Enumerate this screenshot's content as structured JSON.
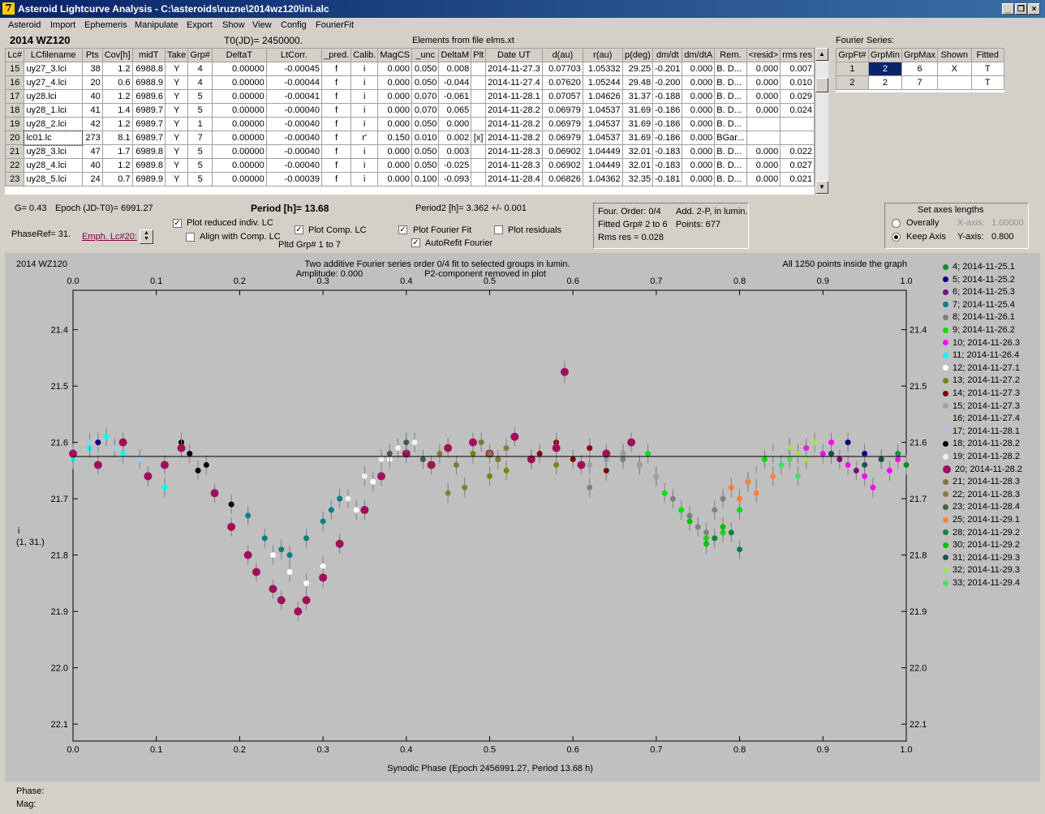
{
  "window": {
    "title": "Asteroid Lightcurve Analysis - C:\\asteroids\\ruzne\\2014wz120\\ini.alc",
    "icon_glyph": "7"
  },
  "menu": [
    "Asteroid",
    "Import",
    "Ephemeris",
    "Manipulate",
    "Export",
    "Show",
    "View",
    "Config",
    "FourierFit"
  ],
  "header": {
    "object": "2014 WZ120",
    "t0": "T0(JD)= 2450000.",
    "elements": "Elements from file elms.xt",
    "fourier_label": "Fourier Series:"
  },
  "table": {
    "columns": [
      "Lc#",
      "LCfilename",
      "Pts",
      "Cov[h]",
      "midT",
      "Take",
      "Grp#",
      "DeltaT",
      "LtCorr.",
      "_pred.",
      "Calib.",
      "MagCS",
      "_unc",
      "DeltaM",
      "Plt",
      "Date UT",
      "d(au)",
      "r(au)",
      "p(deg)",
      "dm/dt",
      "dm/dtA",
      "Rem.",
      "<resid>",
      "rms res"
    ],
    "rows": [
      [
        "15",
        "uy27_3.lci",
        "38",
        "1.2",
        "6988.8",
        "Y",
        "4",
        "0.00000",
        "-0.00045",
        "f",
        "i",
        "0.000",
        "0.050",
        "0.008",
        "",
        "2014-11-27.3",
        "0.07703",
        "1.05332",
        "29.25",
        "-0.201",
        "0.000",
        "B. D...",
        "0.000",
        "0.007"
      ],
      [
        "16",
        "uy27_4.lci",
        "20",
        "0.6",
        "6988.9",
        "Y",
        "4",
        "0.00000",
        "-0.00044",
        "f",
        "i",
        "0.000",
        "0.050",
        "-0.044",
        "",
        "2014-11-27.4",
        "0.07620",
        "1.05244",
        "29.48",
        "-0.200",
        "0.000",
        "B. D...",
        "0.000",
        "0.010"
      ],
      [
        "17",
        "uy28.lci",
        "40",
        "1.2",
        "6989.6",
        "Y",
        "5",
        "0.00000",
        "-0.00041",
        "f",
        "i",
        "0.000",
        "0.070",
        "-0.061",
        "",
        "2014-11-28.1",
        "0.07057",
        "1.04626",
        "31.37",
        "-0.188",
        "0.000",
        "B. D...",
        "0.000",
        "0.029"
      ],
      [
        "18",
        "uy28_1.lci",
        "41",
        "1.4",
        "6989.7",
        "Y",
        "5",
        "0.00000",
        "-0.00040",
        "f",
        "i",
        "0.000",
        "0.070",
        "0.065",
        "",
        "2014-11-28.2",
        "0.06979",
        "1.04537",
        "31.69",
        "-0.186",
        "0.000",
        "B. D...",
        "0.000",
        "0.024"
      ],
      [
        "19",
        "uy28_2.lci",
        "42",
        "1.2",
        "6989.7",
        "Y",
        "1",
        "0.00000",
        "-0.00040",
        "f",
        "i",
        "0.000",
        "0.050",
        "0.000",
        "",
        "2014-11-28.2",
        "0.06979",
        "1.04537",
        "31.69",
        "-0.186",
        "0.000",
        "B. D...",
        "",
        ""
      ],
      [
        "20",
        "lc01.lc",
        "273",
        "8.1",
        "6989.7",
        "Y",
        "7",
        "0.00000",
        "-0.00040",
        "f",
        "r'",
        "0.150",
        "0.010",
        "0.002",
        "[x]",
        "2014-11-28.2",
        "0.06979",
        "1.04537",
        "31.69",
        "-0.186",
        "0.000",
        "BGar...",
        "",
        ""
      ],
      [
        "21",
        "uy28_3.lci",
        "47",
        "1.7",
        "6989.8",
        "Y",
        "5",
        "0.00000",
        "-0.00040",
        "f",
        "i",
        "0.000",
        "0.050",
        "0.003",
        "",
        "2014-11-28.3",
        "0.06902",
        "1.04449",
        "32.01",
        "-0.183",
        "0.000",
        "B. D...",
        "0.000",
        "0.022"
      ],
      [
        "22",
        "uy28_4.lci",
        "40",
        "1.2",
        "6989.8",
        "Y",
        "5",
        "0.00000",
        "-0.00040",
        "f",
        "i",
        "0.000",
        "0.050",
        "-0.025",
        "",
        "2014-11-28.3",
        "0.06902",
        "1.04449",
        "32.01",
        "-0.183",
        "0.000",
        "B. D...",
        "0.000",
        "0.027"
      ],
      [
        "23",
        "uy28_5.lci",
        "24",
        "0.7",
        "6989.9",
        "Y",
        "5",
        "0.00000",
        "-0.00039",
        "f",
        "i",
        "0.000",
        "0.100",
        "-0.093",
        "",
        "2014-11-28.4",
        "0.06826",
        "1.04362",
        "32.35",
        "-0.181",
        "0.000",
        "B. D...",
        "0.000",
        "0.021"
      ]
    ]
  },
  "fourier_table": {
    "columns": [
      "GrpFt#",
      "GrpMin",
      "GrpMax",
      "Shown",
      "Fitted"
    ],
    "rows": [
      [
        "1",
        "2",
        "6",
        "X",
        "T"
      ],
      [
        "2",
        "2",
        "7",
        "",
        "T"
      ]
    ]
  },
  "controls": {
    "g": "G= 0.43",
    "epoch": "Epoch (JD-T0)= 6991.27",
    "period": "Period [h]= 13.68",
    "period2": "Period2 [h]= 3.362 +/- 0.001",
    "phaseref": "PhaseRef= 31.",
    "emph": "Emph. Lc#20:",
    "plot_reduced": "Plot reduced indiv. LC",
    "align": "Align with Comp. LC",
    "plot_comp": "Plot Comp. LC",
    "plotted_grp": "Pltd Grp#  1   to    7",
    "plot_fourier": "Plot Fourier Fit",
    "autorefit": "AutoRefit Fourier",
    "plot_residuals": "Plot residuals",
    "info1": "Four. Order:  0/4",
    "info2": "Add. 2-P, in lumin.",
    "info3": "Fitted Grp# 2 to 6",
    "info4": "Points: 677",
    "info5": "Rms res      = 0.028",
    "axes_title": "Set axes lengths",
    "overally": "Overally",
    "keep_axis": "Keep Axis",
    "xaxis_label": "X-axis:",
    "xaxis_val": "1.00000",
    "yaxis_label": "Y-axis:",
    "yaxis_val": "0.800"
  },
  "chart_data": {
    "type": "scatter",
    "object": "2014 WZ120",
    "title": "Two additive Fourier series order 0/4 fit to selected groups in lumin.",
    "subtitle1": "Amplitude: 0.000",
    "subtitle2": "P2-component removed in plot",
    "note": "All 1250 points inside the graph",
    "xlabel": "Synodic Phase (Epoch 2456991.27, Period 13.68 h)",
    "ylabel": "i",
    "ylabel2": "(1, 31.)",
    "xlim": [
      0.0,
      1.0
    ],
    "ylim": [
      21.33,
      22.13
    ],
    "x_ticks": [
      "0.0",
      "0.1",
      "0.2",
      "0.3",
      "0.4",
      "0.5",
      "0.6",
      "0.7",
      "0.8",
      "0.9",
      "1.0"
    ],
    "y_ticks": [
      "21.4",
      "21.5",
      "21.6",
      "21.7",
      "21.8",
      "21.9",
      "22.0",
      "22.1"
    ],
    "fit_line_y": 21.625,
    "series": [
      {
        "name": "4; 2014-11-25.1",
        "color": "#0a8a2a",
        "x": [
          0.97,
          1.0,
          0.99
        ],
        "y": [
          21.63,
          21.64,
          21.62
        ]
      },
      {
        "name": "5; 2014-11-25.2",
        "color": "#000080",
        "x": [
          0.91,
          0.93,
          0.95,
          0.03
        ],
        "y": [
          21.62,
          21.6,
          21.62,
          21.6
        ]
      },
      {
        "name": "6; 2014-11-25.3",
        "color": "#800080",
        "x": [
          0.92,
          0.94
        ],
        "y": [
          21.63,
          21.65
        ]
      },
      {
        "name": "7; 2014-11-25.4",
        "color": "#008080",
        "x": [
          0.21,
          0.23,
          0.25,
          0.26,
          0.28,
          0.3,
          0.31,
          0.32
        ],
        "y": [
          21.73,
          21.77,
          21.79,
          21.8,
          21.77,
          21.74,
          21.72,
          21.7
        ]
      },
      {
        "name": "8; 2014-11-26.1",
        "color": "#808080",
        "x": [
          0.7,
          0.72,
          0.74,
          0.75,
          0.76,
          0.77,
          0.78,
          0.66,
          0.62
        ],
        "y": [
          21.66,
          21.7,
          21.73,
          21.75,
          21.76,
          21.72,
          21.7,
          21.63,
          21.68
        ]
      },
      {
        "name": "9; 2014-11-26.2",
        "color": "#00e000",
        "x": [
          0.69,
          0.71,
          0.73,
          0.76,
          0.78,
          0.8,
          0.81,
          0.83
        ],
        "y": [
          21.62,
          21.69,
          21.72,
          21.77,
          21.76,
          21.72,
          21.67,
          21.63
        ]
      },
      {
        "name": "10; 2014-11-26.3",
        "color": "#ff00ff",
        "x": [
          0.88,
          0.9,
          0.91,
          0.93,
          0.95,
          0.96,
          0.98,
          0.99
        ],
        "y": [
          21.61,
          21.62,
          21.6,
          21.64,
          21.66,
          21.68,
          21.65,
          21.63
        ]
      },
      {
        "name": "11; 2014-11-26.4",
        "color": "#00ffff",
        "x": [
          0.0,
          0.02,
          0.04,
          0.06,
          0.09,
          0.11
        ],
        "y": [
          21.63,
          21.61,
          21.59,
          21.62,
          21.66,
          21.68
        ]
      },
      {
        "name": "12; 2014-11-27.1",
        "color": "#ffffff",
        "x": [
          0.24,
          0.26,
          0.28,
          0.3,
          0.32,
          0.34,
          0.36,
          0.38,
          0.4
        ],
        "y": [
          21.8,
          21.83,
          21.85,
          21.82,
          21.78,
          21.72,
          21.67,
          21.63,
          21.6
        ]
      },
      {
        "name": "13; 2014-11-27.2",
        "color": "#808000",
        "x": [
          0.48,
          0.5,
          0.52,
          0.55,
          0.58
        ],
        "y": [
          21.62,
          21.66,
          21.65,
          21.63,
          21.64
        ]
      },
      {
        "name": "14; 2014-11-27.3",
        "color": "#800000",
        "x": [
          0.56,
          0.58,
          0.6,
          0.62,
          0.64,
          0.66,
          0.68
        ],
        "y": [
          21.62,
          21.6,
          21.63,
          21.61,
          21.65,
          21.62,
          21.64
        ]
      },
      {
        "name": "15; 2014-11-27.3",
        "color": "#a0a0a0",
        "x": [
          0.62,
          0.64,
          0.66,
          0.68,
          0.7
        ],
        "y": [
          21.64,
          21.63,
          21.62,
          21.64,
          21.66
        ]
      },
      {
        "name": "16; 2014-11-27.4",
        "color": "#c0c0c0",
        "x": [
          0.82,
          0.84,
          0.86,
          0.88
        ],
        "y": [
          21.66,
          21.62,
          21.61,
          21.62
        ]
      },
      {
        "name": "17; 2014-11-28.1",
        "color": "#a8c8e8",
        "x": [
          0.02,
          0.05,
          0.08
        ],
        "y": [
          21.6,
          21.61,
          21.63
        ]
      },
      {
        "name": "18; 2014-11-28.2",
        "color": "#000000",
        "x": [
          0.13,
          0.14,
          0.15,
          0.16,
          0.19
        ],
        "y": [
          21.6,
          21.62,
          21.65,
          21.64,
          21.71
        ]
      },
      {
        "name": "19; 2014-11-28.2",
        "color": "#f0f0f0",
        "x": [
          0.33,
          0.35,
          0.37,
          0.39,
          0.41
        ],
        "y": [
          21.7,
          21.66,
          21.63,
          21.61,
          21.6
        ]
      },
      {
        "name": "20; 2014-11-28.2",
        "color": "#a0105a",
        "x": [
          0.0,
          0.03,
          0.06,
          0.09,
          0.11,
          0.13,
          0.17,
          0.19,
          0.21,
          0.22,
          0.24,
          0.25,
          0.27,
          0.28,
          0.3,
          0.32,
          0.35,
          0.37,
          0.4,
          0.43,
          0.45,
          0.48,
          0.5,
          0.53,
          0.55,
          0.58,
          0.61,
          0.64,
          0.67
        ],
        "y": [
          21.62,
          21.64,
          21.6,
          21.66,
          21.64,
          21.61,
          21.69,
          21.75,
          21.8,
          21.83,
          21.86,
          21.88,
          21.9,
          21.88,
          21.84,
          21.78,
          21.72,
          21.66,
          21.62,
          21.64,
          21.61,
          21.6,
          21.62,
          21.59,
          21.63,
          21.61,
          21.64,
          21.62,
          21.6
        ]
      },
      {
        "name": "21; 2014-11-28.3",
        "color": "#7a7a3a",
        "x": [
          0.44,
          0.46,
          0.49,
          0.51
        ],
        "y": [
          21.62,
          21.64,
          21.6,
          21.63
        ]
      },
      {
        "name": "22; 2014-11-28.3",
        "color": "#8a7a40",
        "x": [
          0.45,
          0.47,
          0.5,
          0.52
        ],
        "y": [
          21.69,
          21.68,
          21.62,
          21.61
        ]
      },
      {
        "name": "23; 2014-11-28.4",
        "color": "#406040",
        "x": [
          0.38,
          0.4,
          0.42
        ],
        "y": [
          21.62,
          21.6,
          21.63
        ]
      },
      {
        "name": "25; 2014-11-29.1",
        "color": "#ff8040",
        "x": [
          0.79,
          0.8,
          0.81,
          0.82,
          0.84
        ],
        "y": [
          21.68,
          21.7,
          21.67,
          21.69,
          21.66
        ]
      },
      {
        "name": "28; 2014-11-29.2",
        "color": "#108040",
        "x": [
          0.77,
          0.79,
          0.8
        ],
        "y": [
          21.77,
          21.76,
          21.79
        ]
      },
      {
        "name": "30; 2014-11-29.2",
        "color": "#00c000",
        "x": [
          0.74,
          0.76,
          0.78
        ],
        "y": [
          21.74,
          21.78,
          21.75
        ]
      },
      {
        "name": "31; 2014-11-29.3",
        "color": "#205050",
        "x": [
          0.91,
          0.95,
          0.97
        ],
        "y": [
          21.62,
          21.64,
          21.63
        ]
      },
      {
        "name": "32; 2014-11-29.3",
        "color": "#a0e060",
        "x": [
          0.86,
          0.87,
          0.88,
          0.89
        ],
        "y": [
          21.61,
          21.62,
          21.63,
          21.6
        ]
      },
      {
        "name": "33; 2014-11-29.4",
        "color": "#40e060",
        "x": [
          0.85,
          0.86,
          0.87
        ],
        "y": [
          21.64,
          21.63,
          21.66
        ]
      }
    ],
    "outlier": {
      "x": 0.59,
      "y": 21.475
    }
  },
  "status": {
    "phase": "Phase:",
    "mag": "Mag:"
  }
}
